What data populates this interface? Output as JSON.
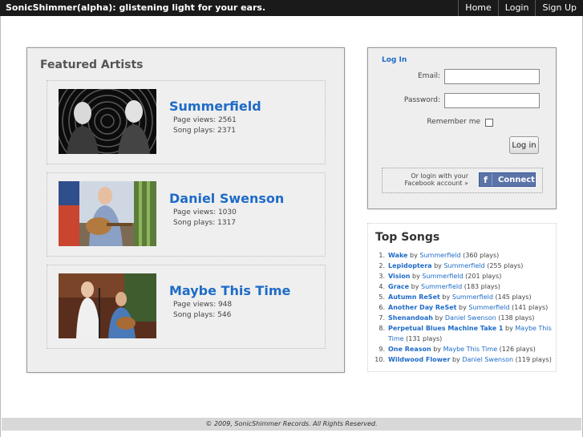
{
  "header": {
    "brand": "SonicShimmer(alpha): glistening light for your ears.",
    "nav": [
      "Home",
      "Login",
      "Sign Up"
    ]
  },
  "featured": {
    "title": "Featured Artists",
    "artists": [
      {
        "name": "Summerfield",
        "page_views": "Page views: 2561",
        "song_plays": "Song plays: 2371"
      },
      {
        "name": "Daniel Swenson",
        "page_views": "Page views: 1030",
        "song_plays": "Song plays: 1317"
      },
      {
        "name": "Maybe This Time",
        "page_views": "Page views: 948",
        "song_plays": "Song plays: 546"
      }
    ]
  },
  "login": {
    "title": "Log In",
    "email_label": "Email:",
    "password_label": "Password:",
    "remember_label": "Remember me",
    "button": "Log in",
    "fb_text": "Or login with your Facebook account »",
    "fb_button": "Connect",
    "fb_glyph": "f"
  },
  "top_songs": {
    "title": "Top Songs",
    "by": "by",
    "items": [
      {
        "num": "1.",
        "song": "Wake",
        "artist": "Summerfield",
        "plays": "(360 plays)"
      },
      {
        "num": "2.",
        "song": "Lepidoptera",
        "artist": "Summerfield",
        "plays": "(255 plays)"
      },
      {
        "num": "3.",
        "song": "Vision",
        "artist": "Summerfield",
        "plays": "(201 plays)"
      },
      {
        "num": "4.",
        "song": "Grace",
        "artist": "Summerfield",
        "plays": "(183 plays)"
      },
      {
        "num": "5.",
        "song": "Autumn ReSet",
        "artist": "Summerfield",
        "plays": "(145 plays)"
      },
      {
        "num": "6.",
        "song": "Another Day ReSet",
        "artist": "Summerfield",
        "plays": "(141 plays)"
      },
      {
        "num": "7.",
        "song": "Shenandoah",
        "artist": "Daniel Swenson",
        "plays": "(138 plays)"
      },
      {
        "num": "8.",
        "song": "Perpetual Blues Machine Take 1",
        "artist": "Maybe This Time",
        "plays": "(131 plays)"
      },
      {
        "num": "9.",
        "song": "One Reason",
        "artist": "Maybe This Time",
        "plays": "(126 plays)"
      },
      {
        "num": "10.",
        "song": "Wildwood Flower",
        "artist": "Daniel Swenson",
        "plays": "(119 plays)"
      }
    ]
  },
  "footer": {
    "text": "© 2009, SonicShimmer Records. All Rights Reserved."
  },
  "colors": {
    "link": "#1e6bc7",
    "topbar": "#1a1a1a",
    "panel": "#eeeeee",
    "facebook": "#5b74a8"
  }
}
